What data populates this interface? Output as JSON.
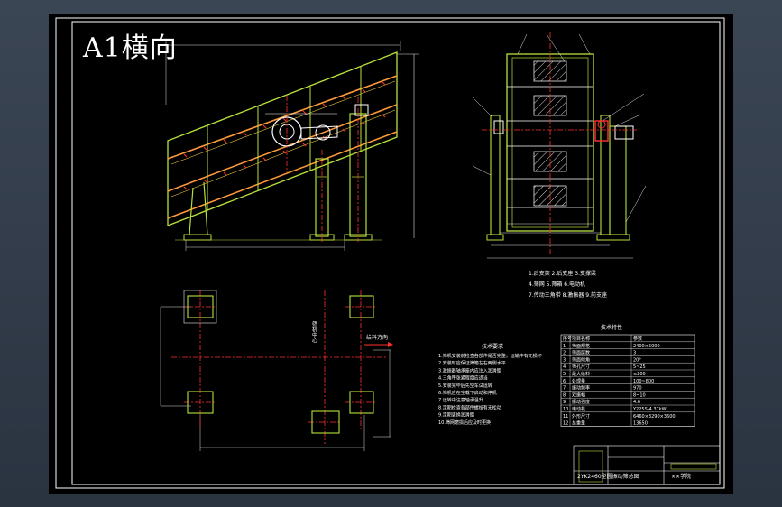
{
  "sheet": {
    "title": "A1横向"
  },
  "legend_lines": [
    "1.后支架    2.后支座    3.支撑梁",
    "4.筛网    5.筛箱    6.电动机",
    "7.传动三角带    8.激振器    9.前支座"
  ],
  "specs_table": {
    "heading": "技术特性",
    "columns": [
      "序号",
      "项目名称",
      "参数"
    ],
    "rows": [
      [
        "1",
        "筛面规格",
        "2400×6000"
      ],
      [
        "2",
        "筛面层数",
        "3"
      ],
      [
        "3",
        "筛面倾角",
        "20°"
      ],
      [
        "4",
        "筛孔尺寸",
        "5~25"
      ],
      [
        "5",
        "最大给料",
        "≤200"
      ],
      [
        "6",
        "处理量",
        "100~800"
      ],
      [
        "7",
        "振动频率",
        "970"
      ],
      [
        "8",
        "双振幅",
        "8~10"
      ],
      [
        "9",
        "振动强度",
        "4.6"
      ],
      [
        "10",
        "电动机",
        "Y225S-4 37kW"
      ],
      [
        "11",
        "外形尺寸",
        "6460×3290×3600"
      ],
      [
        "12",
        "总重量",
        "13650"
      ]
    ]
  },
  "requirements": {
    "heading": "技术要求",
    "lines": [
      "1.筛机安装前检查各部件是否完整，运输中有无损坏",
      "2.安装时应保证筛箱左右两侧水平",
      "3.激振器轴承座内应注入润滑脂",
      "4.三角带张紧程度应适当",
      "5.安装完毕后先空车试运转",
      "6.筛机应在空载下启动和停机",
      "7.运转中注意轴承温升",
      "8.定期检查各部件螺栓有无松动",
      "9.定期更换润滑脂",
      "10.筛网磨损后应及时更换"
    ]
  },
  "plan_view": {
    "arrow_label": "给料方向",
    "center_label": "筛机中心"
  },
  "title_block": {
    "drawing_name": "2YK2460型圆振动筛总图",
    "school": "××学院"
  }
}
